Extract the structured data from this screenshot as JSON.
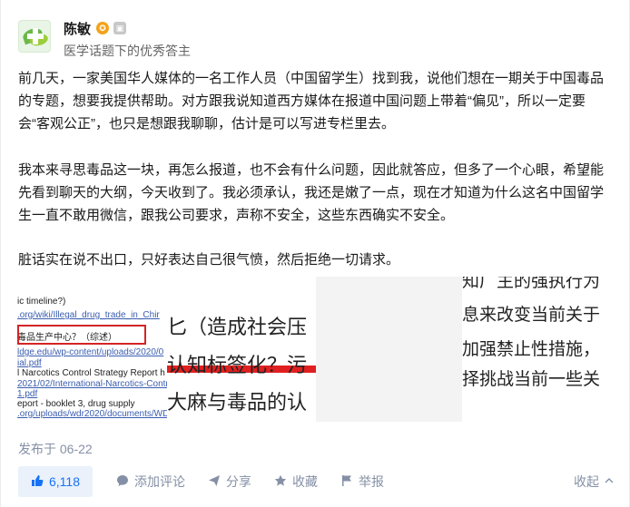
{
  "author": {
    "name": "陈敏",
    "badge_gold": "✪",
    "badge_gray": "▣",
    "description": "医学话题下的优秀答主"
  },
  "content": {
    "paragraphs": [
      "前几天，一家美国华人媒体的一名工作人员（中国留学生）找到我，说他们想在一期关于中国毒品的专题，想要我提供帮助。对方跟我说知道西方媒体在报道中国问题上带着“偏见”，所以一定要会“客观公正”，也只是想跟我聊聊，估计是可以写进专栏里去。",
      "我本来寻思毒品这一块，再怎么报道，也不会有什么问题，因此就答应，但多了一个心眼，希望能先看到聊天的大纲，今天收到了。我必须承认，我还是嫩了一点，现在才知道为什么这名中国留学生一直不敢用微信，跟我公司要求，声称不安全，这些东西确实不安全。",
      "脏话实在说不出口，只好表达自己很气愤，然后拒绝一切请求。"
    ]
  },
  "image_strip": {
    "panel_a": {
      "lines": [
        "ic timeline?)",
        ".org/wiki/Illegal_drug_trade_in_Chir",
        "",
        "毒品生产中心？（综述）",
        "ldge.edu/wp-content/uploads/2020/0",
        "ial.pdf",
        "l Narcotics Control Strategy Report h",
        "2021/02/International-Narcotics-Contr",
        "1.pdf",
        "eport - booklet 3, drug supply",
        ".org/uploads/wdr2020/documents/WD"
      ]
    },
    "panel_b": {
      "lines": [
        "匕（造成社会压",
        "认知标签化？污",
        "大麻与毒品的认"
      ]
    },
    "panel_d": {
      "lines": [
        "知厂主的强执行为",
        "息来改变当前关于",
        "加强禁止性措施，",
        "择挑战当前一些关"
      ]
    }
  },
  "meta": {
    "posted": "发布于 06-22"
  },
  "actions": {
    "vote_count": "6,118",
    "vote_icon": "thumbs-up-icon",
    "comment": "添加评论",
    "share": "分享",
    "favorite": "收藏",
    "report": "举报",
    "collapse": "收起"
  },
  "colors": {
    "accent": "#1772f6",
    "vote_bg": "#eaf1fb",
    "muted": "#8590a6",
    "highlight_red": "#e02020"
  }
}
